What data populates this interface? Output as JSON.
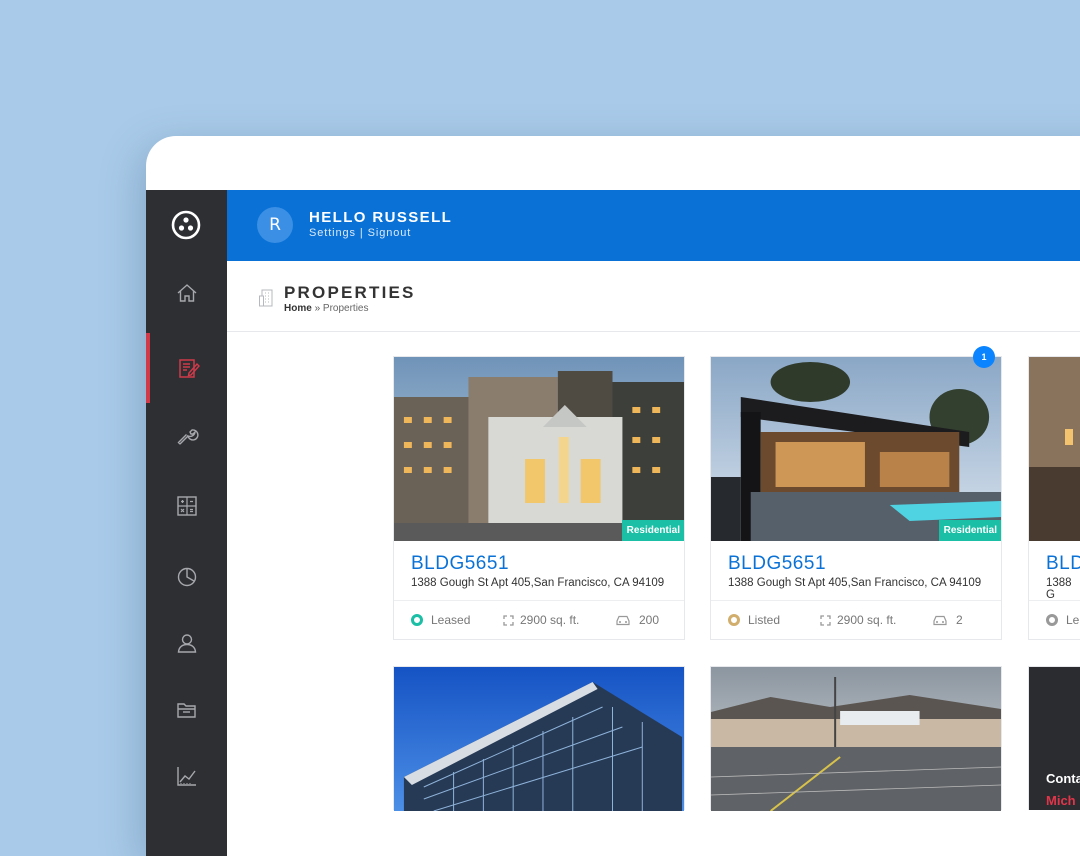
{
  "header": {
    "avatar_initial": "R",
    "greeting": "HELLO RUSSELL",
    "settings_link": "Settings",
    "separator": "|",
    "signout_link": "Signout",
    "bar_color": "#0a72d6"
  },
  "sidebar": {
    "items": [
      {
        "icon": "home-icon",
        "active": false
      },
      {
        "icon": "edit-document-icon",
        "active": true
      },
      {
        "icon": "wrench-icon",
        "active": false
      },
      {
        "icon": "calculator-icon",
        "active": false
      },
      {
        "icon": "pie-chart-icon",
        "active": false
      },
      {
        "icon": "user-icon",
        "active": false
      },
      {
        "icon": "folder-icon",
        "active": false
      },
      {
        "icon": "line-chart-icon",
        "active": false
      }
    ],
    "active_color": "#d23a4a"
  },
  "page": {
    "title": "PROPERTIES",
    "breadcrumb_home": "Home",
    "breadcrumb_sep": "»",
    "breadcrumb_current": "Properties"
  },
  "properties": [
    {
      "id": "BLDG5651",
      "address": "1388 Gough St Apt 405,San Francisco, CA 94109",
      "type": "Residential",
      "status": "Leased",
      "area": "2900 sq. ft.",
      "parking": "200"
    },
    {
      "id": "BLDG5651",
      "address": "1388 Gough St Apt 405,San Francisco, CA 94109",
      "type": "Residential",
      "status": "Listed",
      "area": "2900 sq. ft.",
      "parking": "2",
      "badge": "1"
    },
    {
      "id": "BLD",
      "address": "1388 G",
      "status": "Le"
    }
  ],
  "partial_card": {
    "title": "Conta",
    "name": "Mich"
  },
  "colors": {
    "accent": "#0a72d6",
    "tag": "#1bbfa5",
    "leased": "#1bbfa5",
    "listed": "#d2ae6d"
  }
}
